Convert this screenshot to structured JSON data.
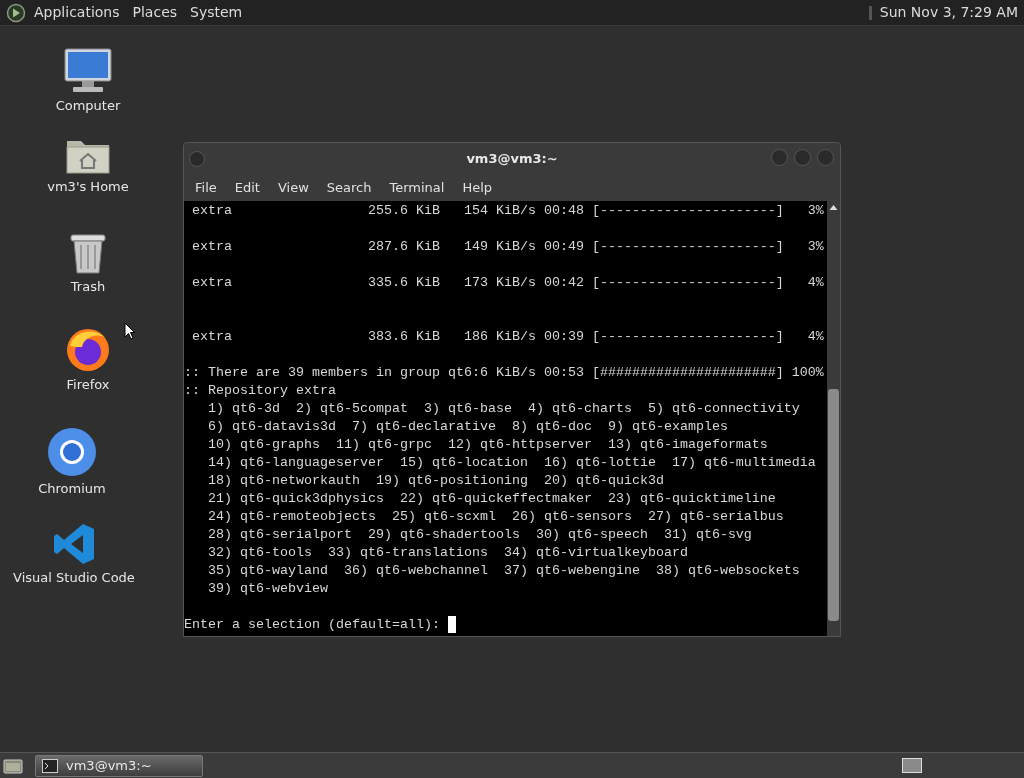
{
  "top_panel": {
    "menus": [
      "Applications",
      "Places",
      "System"
    ],
    "clock": "Sun Nov 3, 7:29 AM"
  },
  "desktop_icons": [
    {
      "kind": "computer",
      "label": "Computer"
    },
    {
      "kind": "home",
      "label": "vm3's Home"
    },
    {
      "kind": "trash",
      "label": "Trash"
    },
    {
      "kind": "firefox",
      "label": "Firefox"
    },
    {
      "kind": "chromium",
      "label": "Chromium"
    },
    {
      "kind": "vscode",
      "label": "Visual Studio Code"
    }
  ],
  "terminal": {
    "title": "vm3@vm3:~",
    "menu": [
      "File",
      "Edit",
      "View",
      "Search",
      "Terminal",
      "Help"
    ],
    "lines": [
      {
        "kind": "text",
        "text": " extra                 255.6 KiB   154 KiB/s 00:48 [----------------------]   3%"
      },
      {
        "kind": "blank"
      },
      {
        "kind": "text",
        "text": " extra                 287.6 KiB   149 KiB/s 00:49 [----------------------]   3%"
      },
      {
        "kind": "blank"
      },
      {
        "kind": "text",
        "text": " extra                 335.6 KiB   173 KiB/s 00:42 [----------------------]   4%"
      },
      {
        "kind": "blank"
      },
      {
        "kind": "blank"
      },
      {
        "kind": "text",
        "text": " extra                 383.6 KiB   186 KiB/s 00:39 [----------------------]   4%"
      },
      {
        "kind": "blank"
      },
      {
        "kind": "text",
        "text": ":: There are 39 members in group qt6:6 KiB/s 00:53 [######################] 100%"
      },
      {
        "kind": "text",
        "text": ":: Repository extra"
      },
      {
        "kind": "text",
        "text": "   1) qt6-3d  2) qt6-5compat  3) qt6-base  4) qt6-charts  5) qt6-connectivity"
      },
      {
        "kind": "text",
        "text": "   6) qt6-datavis3d  7) qt6-declarative  8) qt6-doc  9) qt6-examples"
      },
      {
        "kind": "text",
        "text": "   10) qt6-graphs  11) qt6-grpc  12) qt6-httpserver  13) qt6-imageformats"
      },
      {
        "kind": "text",
        "text": "   14) qt6-languageserver  15) qt6-location  16) qt6-lottie  17) qt6-multimedia"
      },
      {
        "kind": "text",
        "text": "   18) qt6-networkauth  19) qt6-positioning  20) qt6-quick3d"
      },
      {
        "kind": "text",
        "text": "   21) qt6-quick3dphysics  22) qt6-quickeffectmaker  23) qt6-quicktimeline"
      },
      {
        "kind": "text",
        "text": "   24) qt6-remoteobjects  25) qt6-scxml  26) qt6-sensors  27) qt6-serialbus"
      },
      {
        "kind": "text",
        "text": "   28) qt6-serialport  29) qt6-shadertools  30) qt6-speech  31) qt6-svg"
      },
      {
        "kind": "text",
        "text": "   32) qt6-tools  33) qt6-translations  34) qt6-virtualkeyboard"
      },
      {
        "kind": "text",
        "text": "   35) qt6-wayland  36) qt6-webchannel  37) qt6-webengine  38) qt6-websockets"
      },
      {
        "kind": "text",
        "text": "   39) qt6-webview"
      },
      {
        "kind": "blank"
      },
      {
        "kind": "prompt",
        "text": "Enter a selection (default=all): "
      }
    ]
  },
  "taskbar": {
    "tasks": [
      {
        "label": "vm3@vm3:~",
        "selected": true
      }
    ]
  }
}
